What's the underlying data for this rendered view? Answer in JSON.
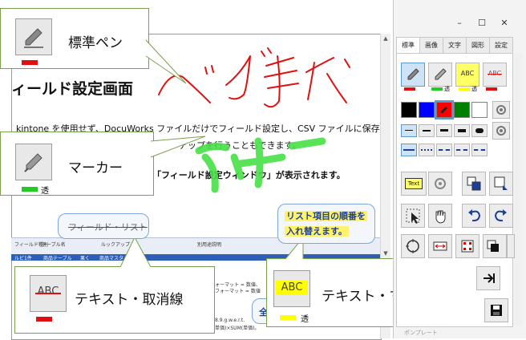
{
  "document": {
    "heading": "ィールド設定画面",
    "lines": [
      "kintone を使用せず、DocuWorks ファイルだけでフィールド設定し、CSV ファイルに保存",
      "ルックアップを行うこともできます。",
      "「フィールド設定ウィンドウ」が表示されます。"
    ],
    "handwriting_pen": "ペンで書く",
    "handwriting_marker": "マーカー",
    "table_header_cells": [
      "フィールド種別",
      "テーブル名",
      "ルックアップ",
      "",
      "別用途説明"
    ],
    "table_row_cells": [
      "ルビ1件",
      "商品テーブル",
      "果く",
      "商品マスタ"
    ],
    "fragments": [
      "ォーマット = 数値、",
      "フォーマット = 数値",
      "8.9.g.w.e.r.t.",
      "単価)×SUM(単価)。"
    ],
    "bubble_text": "全"
  },
  "callouts": {
    "pen": {
      "label": "標準ペン",
      "swatch_color": "#e01010"
    },
    "marker": {
      "label": "マーカー",
      "swatch_color": "#22cc22",
      "suffix": "透"
    },
    "strike": {
      "label": "テキスト・取消線",
      "icon_text": "ABC",
      "swatch_color": "#e01010"
    },
    "text_marker": {
      "label": "テキスト・マーカー",
      "icon_text": "ABC",
      "swatch_color": "#ffff00",
      "suffix": "透"
    }
  },
  "bubbles": {
    "field_list": "フィールド・リスト",
    "reorder_line1": "リスト項目の順番を",
    "reorder_line2": "入れ替えます。"
  },
  "panel": {
    "window_controls": [
      "–",
      "☐",
      "✕"
    ],
    "tabs": [
      "標準",
      "画像",
      "文字",
      "図形",
      "設定"
    ],
    "active_tab": "標準",
    "tools_row1_suffixes": [
      "透",
      "透"
    ],
    "tools_row1_text": [
      "ABC",
      "ABC"
    ],
    "tools_row1_colors": [
      "#e01010",
      "#22cc22",
      "#ffff00",
      "#e01010"
    ],
    "palette": [
      "#000000",
      "#0000ff",
      "#ff0000",
      "#008000",
      "#ffffff"
    ],
    "text_tool_label": "Text",
    "bottom_label": "ポンプレート"
  }
}
